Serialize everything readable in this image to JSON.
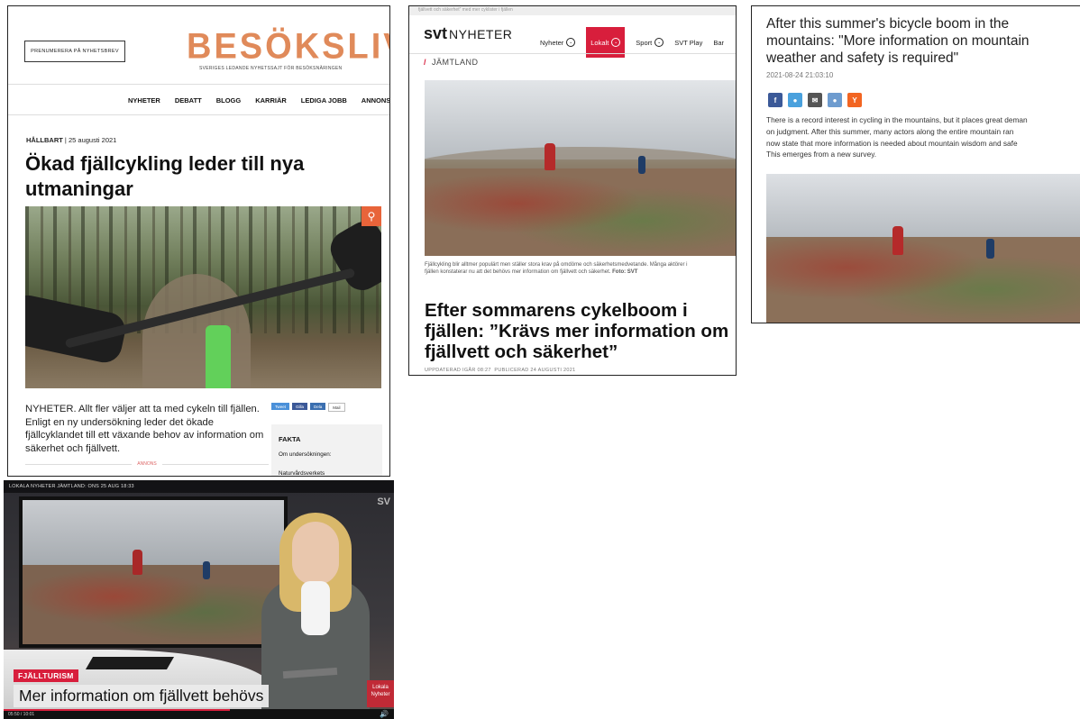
{
  "besoksliv": {
    "subscribe_label": "PRENUMERERA PÅ NYHETSBREV",
    "logo": "BESÖKSLIV",
    "tagline": "SVERIGES LEDANDE NYHETSSAJT FÖR BESÖKSNÄRINGEN",
    "nav": [
      "NYHETER",
      "DEBATT",
      "BLOGG",
      "KARRIÄR",
      "LEDIGA JOBB",
      "ANNONSE"
    ],
    "kicker_category": "HÅLLBART",
    "kicker_separator": "|",
    "kicker_date": "25 augusti 2021",
    "headline": "Ökad fjällcykling leder till nya utmaningar",
    "zoom_icon": "magnifier-icon",
    "lead": "NYHETER. Allt fler väljer att ta med cykeln till fjällen. Enligt en ny undersökning leder det ökade fjällcyklandet till ett växande behov av information om säkerhet och fjällvett.",
    "annons": "ANNONS",
    "share": {
      "tweet": "Tweet",
      "gilla": "Gilla",
      "dela": "Dela",
      "mail": "Mail"
    },
    "fakta_title": "FAKTA",
    "fakta_line1": "Om undersökningen:",
    "fakta_line2": "Naturvårdsverkets"
  },
  "svt": {
    "top_strip": "fjällvett och säkerhet” med mer cyklister i fjällen",
    "logo_bold": "svt",
    "logo_light": "NYHETER",
    "nav": [
      {
        "label": "Nyheter",
        "active": false,
        "chevron": true
      },
      {
        "label": "Lokalt",
        "active": true,
        "chevron": true
      },
      {
        "label": "Sport",
        "active": false,
        "chevron": true
      },
      {
        "label": "SVT Play",
        "active": false,
        "chevron": false
      },
      {
        "label": "Bar",
        "active": false,
        "chevron": false
      }
    ],
    "region": "JÄMTLAND",
    "caption": "Fjällcykling blir alltmer populärt men ställer stora krav på omdöme och säkerhetsmedvetande. Många aktörer i fjällen konstaterar nu att det behövs mer information om fjällvett och säkerhet.",
    "caption_credit": "Foto: SVT",
    "headline": "Efter sommarens cykelboom i fjällen: ”Krävs mer information om fjällvett och säkerhet”",
    "meta_updated": "UPPDATERAD IGÅR 08:27",
    "meta_published": "PUBLICERAD 24 AUGUSTI 2021",
    "accent": "#d81e3c"
  },
  "translation": {
    "headline": "After this summer's bicycle boom in the mountains: \"More information on mountain weather and safety is required\"",
    "date": "2021-08-24 21:03:10",
    "icons": [
      "facebook-icon",
      "twitter-icon",
      "email-icon",
      "vk-icon",
      "ycombinator-icon"
    ],
    "body_lines": [
      "There is a record interest in cycling in the mountains, but it places great deman",
      "on judgment. After this summer, many actors along the entire mountain ran",
      "now state that more information is needed about mountain wisdom and safe",
      "This emerges from a new survey."
    ]
  },
  "broadcast": {
    "top_bar": "LOKALA NYHETER JÄMTLAND: ONS 25 AUG 18:33",
    "corner_mark": "SV",
    "tag": "FJÄLLTURISM",
    "lower_third": "Mer information om fjällvett behövs",
    "corner_box_line1": "Lokala",
    "corner_box_line2": "Nyheter",
    "time": "05:50 / 10:01",
    "progress": 0.58,
    "volume_icon": "volume-icon"
  }
}
